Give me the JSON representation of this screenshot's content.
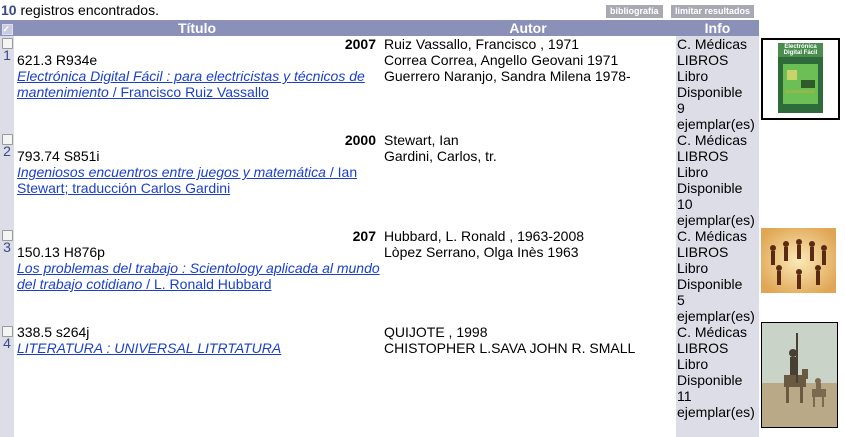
{
  "header": {
    "count": "10",
    "count_suffix": "registros encontrados.",
    "btn_bibliografia": "bibliografía",
    "btn_limitar": "limitar resultados"
  },
  "columns": {
    "titulo": "Título",
    "autor": "Autor",
    "info": "Info"
  },
  "records": [
    {
      "num": "1",
      "year": "2007",
      "call": "621.3 R934e",
      "title": "Electrónica Digital Fácil : para electricistas y técnicos de mantenimiento",
      "responsibility": " / Francisco Ruiz Vassallo",
      "authors": [
        "Ruiz Vassallo, Francisco , 1971",
        "Correa Correa, Angello Geovani 1971",
        "Guerrero Naranjo, Sandra Milena 1978-"
      ],
      "info": [
        "C. Médicas",
        "LIBROS",
        "Libro",
        "Disponible",
        "9",
        "ejemplar(es)"
      ]
    },
    {
      "num": "2",
      "year": "2000",
      "call": "793.74 S851i",
      "title": "Ingeniosos encuentros entre juegos y matemática",
      "responsibility": " / Ian Stewart; traducción Carlos Gardini",
      "authors": [
        "Stewart, Ian",
        "Gardini, Carlos, tr."
      ],
      "info": [
        "C. Médicas",
        "LIBROS",
        "Libro",
        "Disponible",
        "10",
        "ejemplar(es)"
      ]
    },
    {
      "num": "3",
      "year": "207",
      "call": "150.13 H876p",
      "title": "Los problemas del trabajo : Scientology aplicada al mundo del trabajo cotidiano",
      "responsibility": " / L. Ronald Hubbard",
      "authors": [
        "Hubbard, L. Ronald , 1963-2008",
        "Lòpez Serrano, Olga Inès 1963"
      ],
      "info": [
        "C. Médicas",
        "LIBROS",
        "Libro",
        "Disponible",
        "5",
        "ejemplar(es)"
      ]
    },
    {
      "num": "4",
      "year": "",
      "call": "338.5 s264j",
      "title": "LITERATURA : UNIVERSAL LITRTATURA",
      "responsibility": "",
      "authors": [
        "QUIJOTE , 1998",
        "CHISTOPHER L.SAVA JOHN R. SMALL"
      ],
      "info": [
        "C. Médicas",
        "LIBROS",
        "Libro",
        "Disponible",
        "11",
        "ejemplar(es)"
      ]
    }
  ],
  "thumbnails": {
    "cover1_text": "Electrónica Digital Fácil"
  },
  "colors": {
    "header_bg": "#8a90b8",
    "side_bg": "#dcdde6",
    "link": "#1a3fcc"
  }
}
